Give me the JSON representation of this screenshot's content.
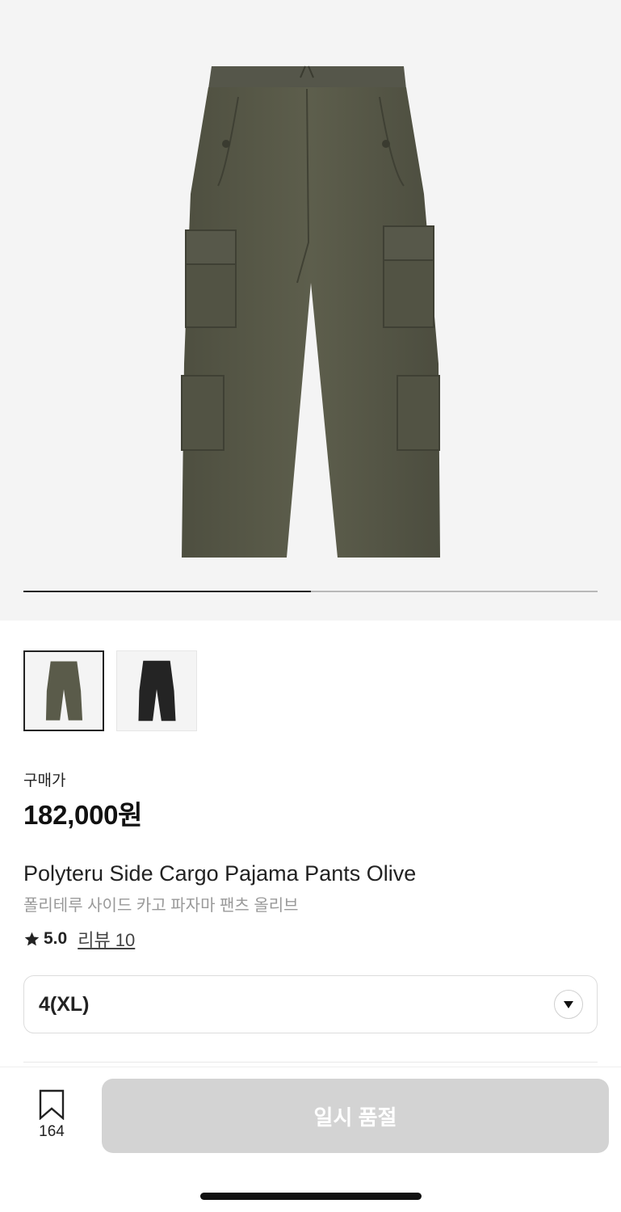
{
  "gallery": {
    "progress": 0.5,
    "thumbnails": [
      {
        "color_name": "olive",
        "color": "#5a5b4a",
        "selected": true
      },
      {
        "color_name": "black",
        "color": "#242424",
        "selected": false
      }
    ]
  },
  "product": {
    "price_label": "구매가",
    "price": "182,000원",
    "name_en": "Polyteru Side Cargo Pajama Pants Olive",
    "name_ko": "폴리테루 사이드 카고 파자마 팬츠 올리브",
    "rating": "5.0",
    "review_label": "리뷰 10"
  },
  "option": {
    "selected_size": "4(XL)"
  },
  "bottom_bar": {
    "bookmark_count": "164",
    "sold_out_label": "일시 품절"
  },
  "colors": {
    "accent": "#222222",
    "disabled_button": "#d3d3d3",
    "hero_background": "#f4f4f4"
  }
}
